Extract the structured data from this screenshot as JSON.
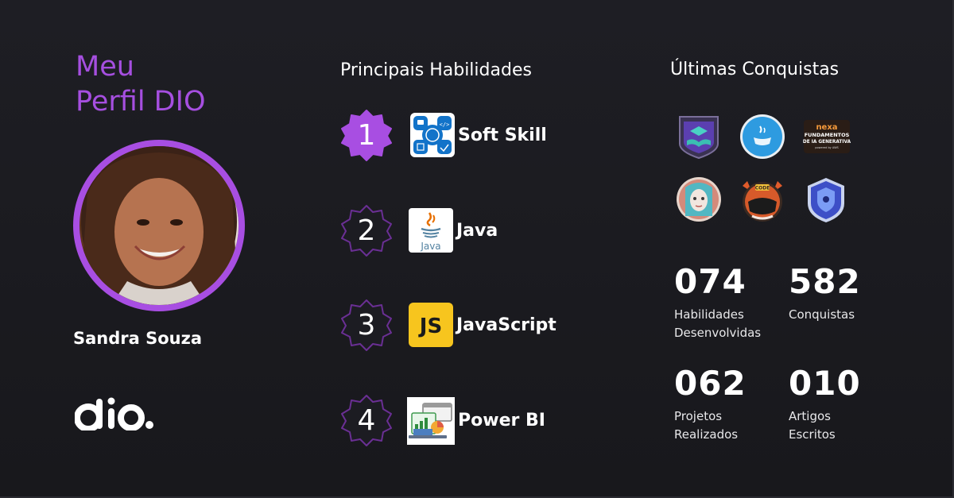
{
  "profile": {
    "title_line1": "Meu",
    "title_line2": "Perfil DIO",
    "name": "Sandra Souza",
    "brand": "dio."
  },
  "skills": {
    "title": "Principais Habilidades",
    "items": [
      {
        "rank": "1",
        "label": "Soft Skill",
        "icon": "soft-skill-icon"
      },
      {
        "rank": "2",
        "label": "Java",
        "icon": "java-icon",
        "icon_text": "Java"
      },
      {
        "rank": "3",
        "label": "JavaScript",
        "icon": "javascript-icon",
        "icon_text": "JS"
      },
      {
        "rank": "4",
        "label": "Power BI",
        "icon": "power-bi-icon"
      }
    ]
  },
  "achievements": {
    "title": "Últimas Conquistas",
    "badges": [
      {
        "name": "book-shield-badge"
      },
      {
        "name": "java-cup-badge"
      },
      {
        "name": "nexa-badge",
        "line1": "nexa",
        "line2": "FUNDAMENTOS",
        "line3": "DE IA GENERATIVA",
        "line4": "powered by AWS"
      },
      {
        "name": "portrait-badge"
      },
      {
        "name": "code-helmet-badge",
        "text": "CODE"
      },
      {
        "name": "security-shield-badge"
      }
    ]
  },
  "stats": [
    {
      "value": "074",
      "label_line1": "Habilidades",
      "label_line2": "Desenvolvidas"
    },
    {
      "value": "582",
      "label_line1": "Conquistas",
      "label_line2": ""
    },
    {
      "value": "062",
      "label_line1": "Projetos",
      "label_line2": "Realizados"
    },
    {
      "value": "010",
      "label_line1": "Artigos",
      "label_line2": "Escritos"
    }
  ],
  "colors": {
    "background": "#1e1e24",
    "accent_purple": "#a64fe0",
    "text": "#ffffff"
  }
}
